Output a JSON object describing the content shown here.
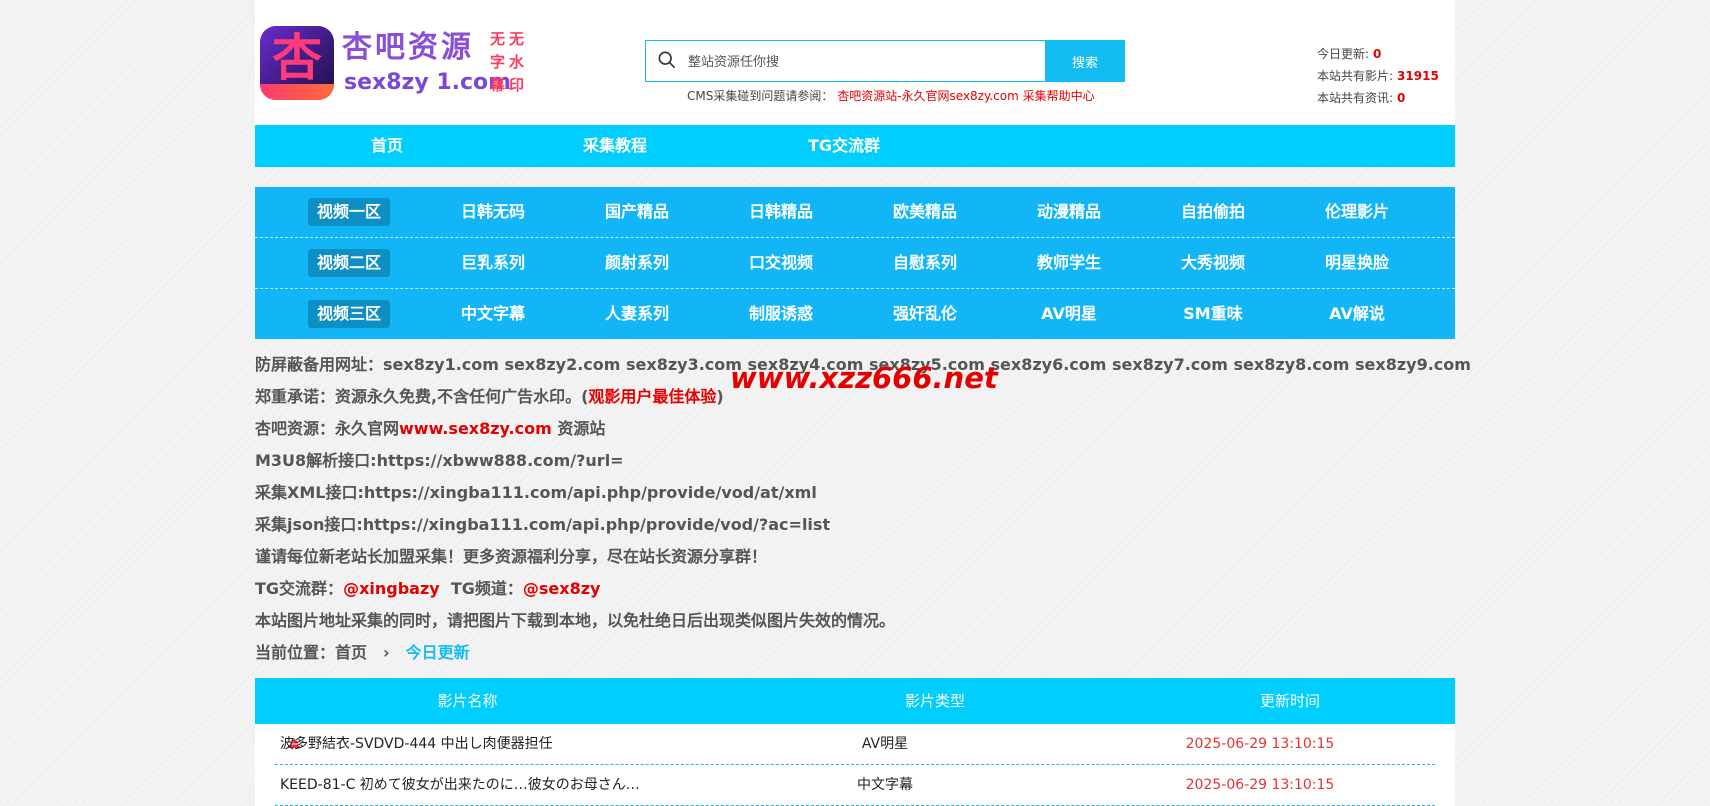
{
  "brand": {
    "title": "杏吧资源",
    "domain": "sex8zy 1.com",
    "tagline": "无无字水幕印",
    "mark_glyph": "杏"
  },
  "search": {
    "placeholder": "整站资源任你搜",
    "button_label": "搜索",
    "help_prefix": "CMS采集碰到问题请参阅：",
    "help_link": "杏吧资源站-永久官网sex8zy.com 采集帮助中心"
  },
  "stats": [
    {
      "label": "今日更新:",
      "value": "0"
    },
    {
      "label": "本站共有影片:",
      "value": "31915"
    },
    {
      "label": "本站共有资讯:",
      "value": "0"
    }
  ],
  "main_nav": [
    "首页",
    "采集教程",
    "TG交流群"
  ],
  "category_rows": [
    {
      "zone": "视频一区",
      "items": [
        "日韩无码",
        "国产精品",
        "日韩精品",
        "欧美精品",
        "动漫精品",
        "自拍偷拍",
        "伦理影片"
      ]
    },
    {
      "zone": "视频二区",
      "items": [
        "巨乳系列",
        "颜射系列",
        "口交视频",
        "自慰系列",
        "教师学生",
        "大秀视频",
        "明星换脸"
      ]
    },
    {
      "zone": "视频三区",
      "items": [
        "中文字幕",
        "人妻系列",
        "制服诱惑",
        "强奸乱伦",
        "AV明星",
        "SM重味",
        "AV解说"
      ]
    }
  ],
  "notices": {
    "mirrors": "防屏蔽备用网址：sex8zy1.com sex8zy2.com sex8zy3.com sex8zy4.com sex8zy5.com sex8zy6.com sex8zy7.com sex8zy8.com sex8zy9.com",
    "promise_prefix": "郑重承诺：资源永久免费,不含任何广告水印。(",
    "promise_highlight": "观影用户最佳体验",
    "promise_suffix": ")",
    "official_prefix": "杏吧资源：永久官网",
    "official_link": "www.sex8zy.com",
    "official_suffix": " 资源站",
    "m3u8": "M3U8解析接口:https://xbww888.com/?url=",
    "xml": "采集XML接口:https://xingba111.com/api.php/provide/vod/at/xml",
    "json": "采集json接口:https://xingba111.com/api.php/provide/vod/?ac=list",
    "join": "谨请每位新老站长加盟采集！更多资源福利分享，尽在站长资源分享群！",
    "tg_group_label": "TG交流群：",
    "tg_group": "@xingbazy",
    "tg_channel_label": "TG频道：",
    "tg_channel": "@sex8zy",
    "image_tip": "本站图片地址采集的同时，请把图片下载到本地，以免杜绝日后出现类似图片失效的情况。"
  },
  "watermark": "www.xzz666.net",
  "breadcrumb": {
    "label": "当前位置：",
    "home": "首页",
    "separator": "›",
    "current": "今日更新"
  },
  "table": {
    "headers": [
      "影片名称",
      "影片类型",
      "更新时间"
    ],
    "rows": [
      {
        "title": "波多野結衣-SVDVD-444 中出し肉便器担任",
        "type": "AV明星",
        "time": "2025-06-29 13:10:15",
        "hot": true
      },
      {
        "title": "KEED-81-C 初めて彼女が出来たのに…彼女のお母さん…",
        "type": "中文字幕",
        "time": "2025-06-29 13:10:15",
        "hot": false
      }
    ]
  },
  "colors": {
    "accent": "#00ceff",
    "category_bg": "#12b6f7",
    "highlight_red": "#e50000",
    "link_blue": "#13bdf2"
  }
}
